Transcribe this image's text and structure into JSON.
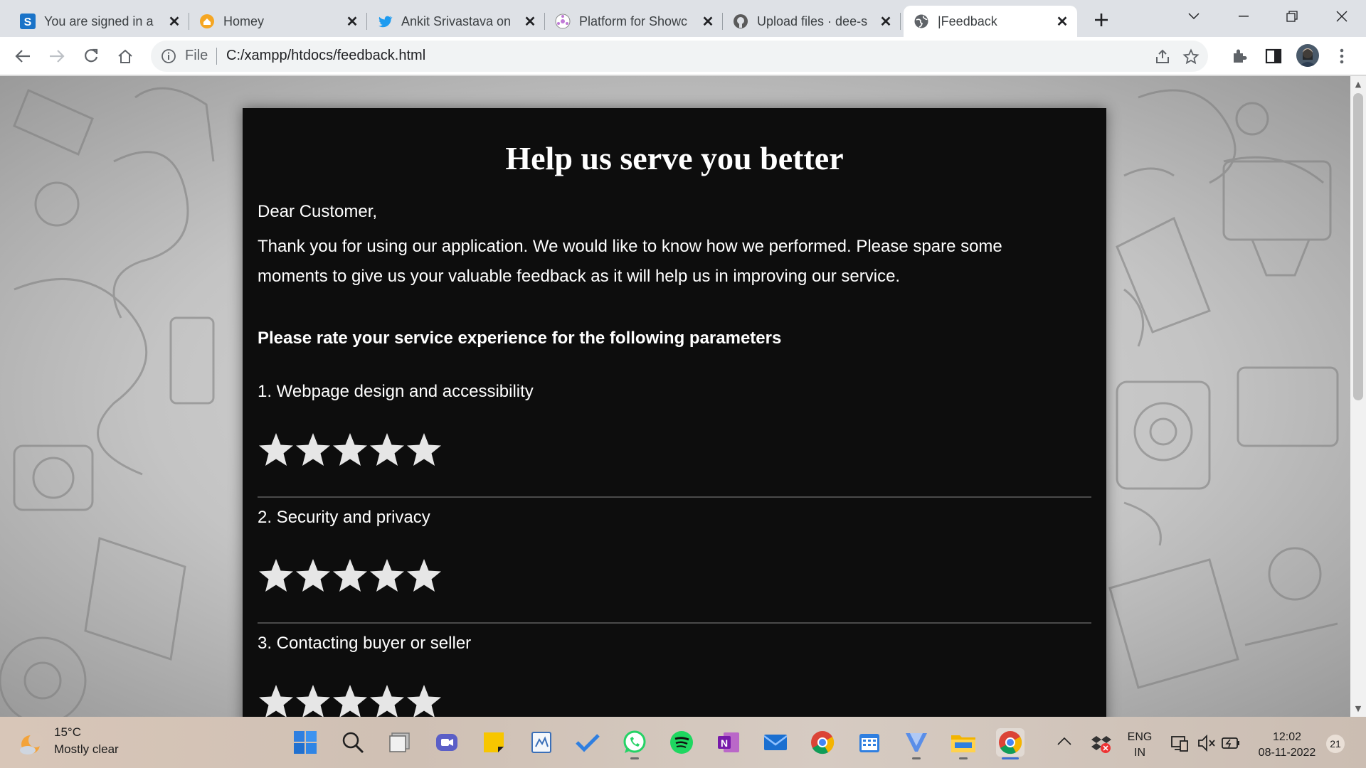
{
  "browser": {
    "tabs": [
      {
        "title": "You are signed in a",
        "icon": "s-app-icon"
      },
      {
        "title": "Homey",
        "icon": "homey-icon"
      },
      {
        "title": "Ankit Srivastava on",
        "icon": "twitter-icon"
      },
      {
        "title": "Platform for Showc",
        "icon": "platform-icon"
      },
      {
        "title": "Upload files · dee-s",
        "icon": "github-icon"
      },
      {
        "title": "|Feedback",
        "icon": "globe-icon",
        "active": true
      }
    ],
    "address": {
      "scheme_label": "File",
      "url": "C:/xampp/htdocs/feedback.html"
    }
  },
  "page": {
    "heading": "Help us serve you better",
    "greeting": "Dear Customer,",
    "intro": "Thank you for using our application. We would like to know how we performed. Please spare some moments to give us your valuable feedback as it will help us in improving our service.",
    "subheading": "Please rate your service experience for the following parameters",
    "questions": [
      {
        "label": "1. Webpage design and accessibility",
        "rating_max": 5
      },
      {
        "label": "2. Security and privacy",
        "rating_max": 5
      },
      {
        "label": "3. Contacting buyer or seller",
        "rating_max": 5
      }
    ]
  },
  "taskbar": {
    "weather": {
      "temp": "15°C",
      "desc": "Mostly clear"
    },
    "tray": {
      "lang": "ENG",
      "region": "IN",
      "time": "12:02",
      "date": "08-11-2022",
      "notifications": "21"
    },
    "colors": {
      "accent": "#3b6fd1",
      "card_bg": "#0d0d0d",
      "star_color": "#e6e6e6"
    }
  }
}
